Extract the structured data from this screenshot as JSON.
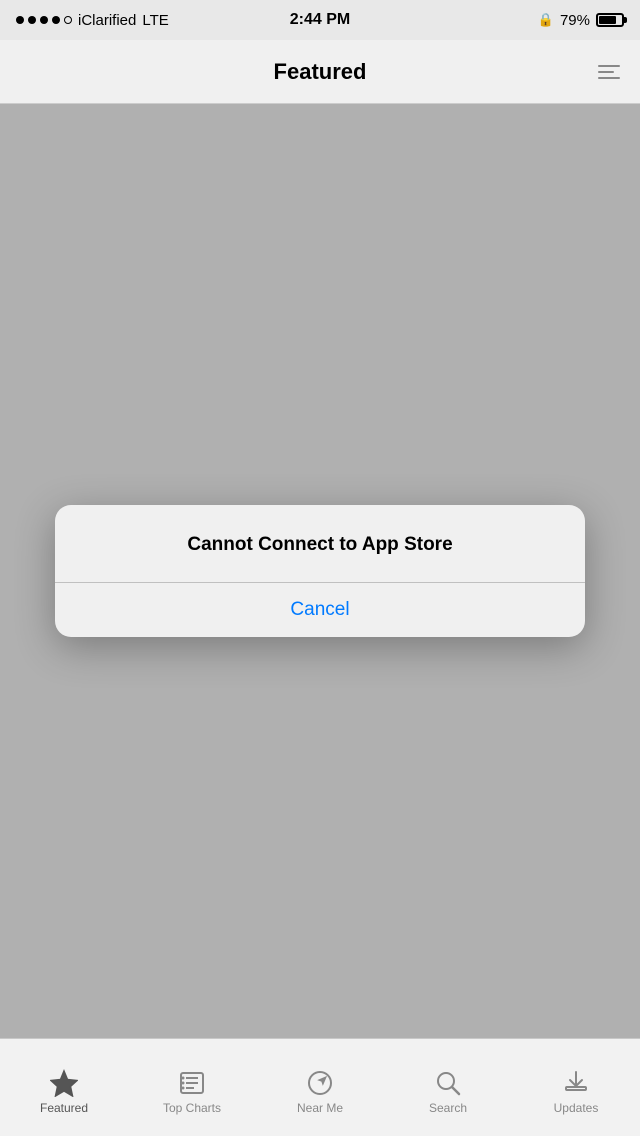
{
  "status_bar": {
    "carrier": "iClarified",
    "network": "LTE",
    "time": "2:44 PM",
    "battery_percent": "79%"
  },
  "nav_bar": {
    "title": "Featured",
    "list_icon_label": "list-icon"
  },
  "alert": {
    "title": "Cannot Connect to App Store",
    "cancel_label": "Cancel"
  },
  "tab_bar": {
    "items": [
      {
        "id": "featured",
        "label": "Featured",
        "active": true
      },
      {
        "id": "top-charts",
        "label": "Top Charts",
        "active": false
      },
      {
        "id": "near-me",
        "label": "Near Me",
        "active": false
      },
      {
        "id": "search",
        "label": "Search",
        "active": false
      },
      {
        "id": "updates",
        "label": "Updates",
        "active": false
      }
    ]
  }
}
